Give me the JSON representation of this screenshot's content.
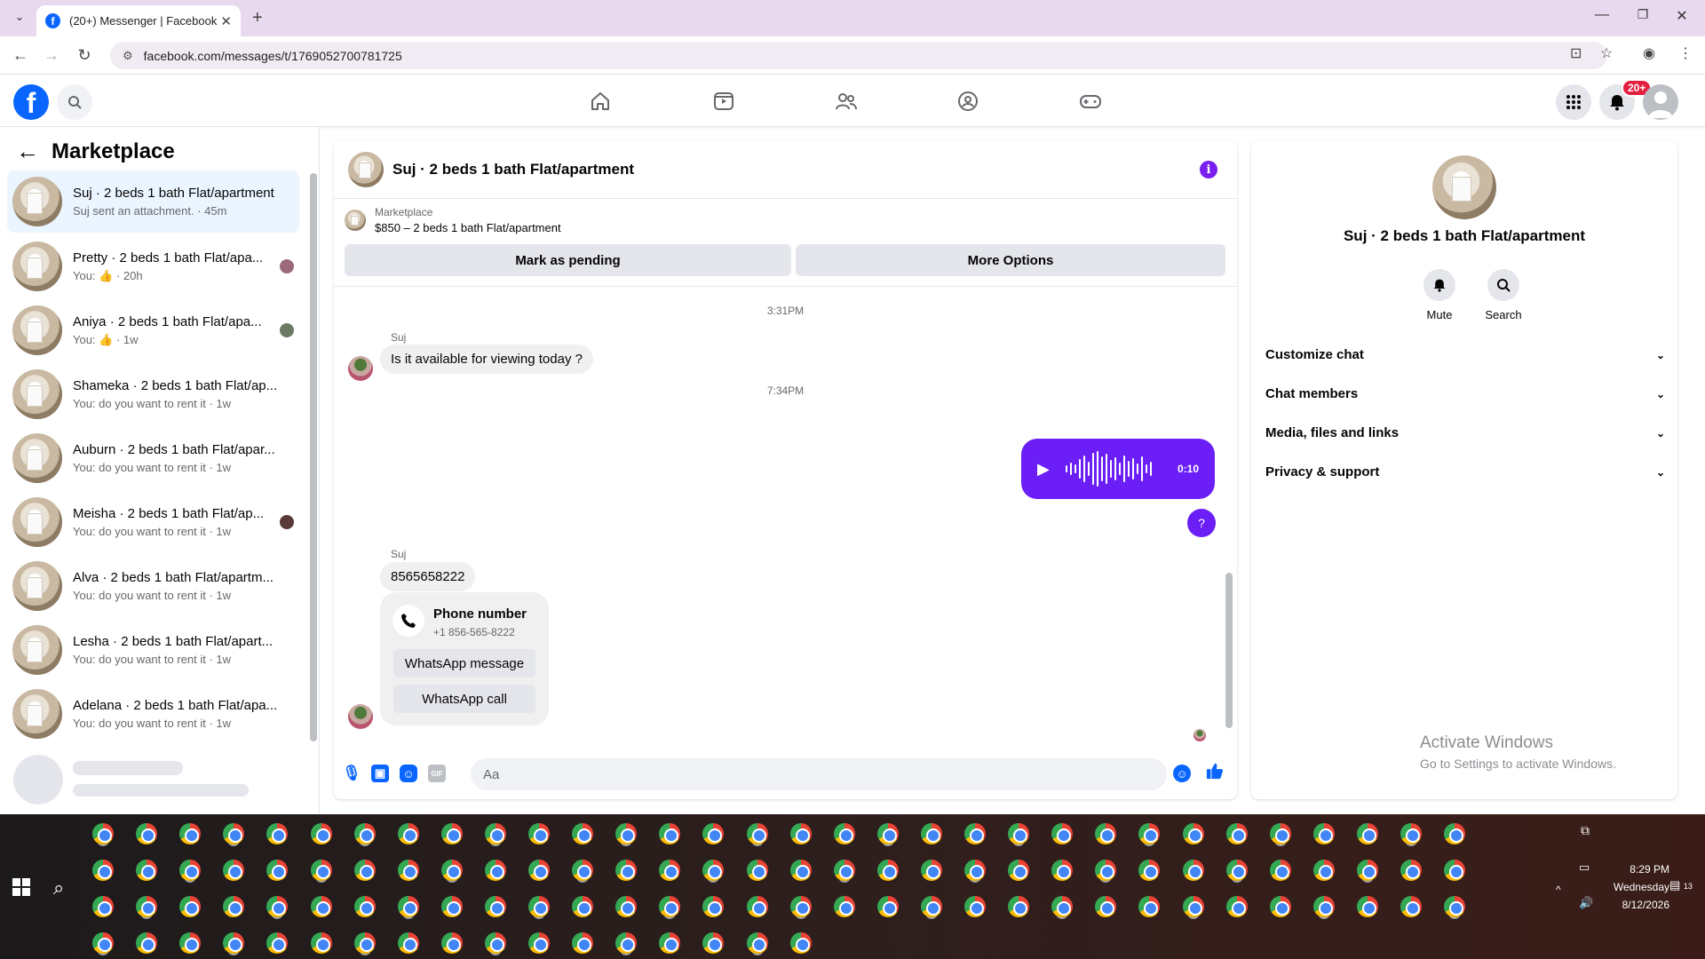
{
  "browser": {
    "tab_title": "(20+) Messenger | Facebook",
    "url": "facebook.com/messages/t/1769052700781725"
  },
  "header": {
    "notifications_badge": "20+"
  },
  "sidebar": {
    "title": "Marketplace",
    "conversations": [
      {
        "name": "Suj · 2 beds 1 bath Flat/apartment",
        "sub": "Suj sent an attachment. · 45m",
        "active": true
      },
      {
        "name": "Pretty · 2 beds 1 bath Flat/apa...",
        "sub": "You: 👍 · 20h"
      },
      {
        "name": "Aniya · 2 beds 1 bath Flat/apa...",
        "sub": "You: 👍 · 1w"
      },
      {
        "name": "Shameka · 2 beds 1 bath Flat/ap...",
        "sub": "You: do you want to rent it · 1w"
      },
      {
        "name": "Auburn · 2 beds 1 bath Flat/apar...",
        "sub": "You: do you want to rent it · 1w"
      },
      {
        "name": "Meisha · 2 beds 1 bath Flat/ap...",
        "sub": "You: do you want to rent it · 1w"
      },
      {
        "name": "Alva · 2 beds 1 bath Flat/apartm...",
        "sub": "You: do you want to rent it · 1w"
      },
      {
        "name": "Lesha · 2 beds 1 bath Flat/apart...",
        "sub": "You: do you want to rent it · 1w"
      },
      {
        "name": "Adelana · 2 beds 1 bath Flat/apa...",
        "sub": "You: do you want to rent it · 1w"
      }
    ]
  },
  "chat": {
    "title": "Suj · 2 beds 1 bath Flat/apartment",
    "listing_label": "Marketplace",
    "listing_text": "$850 – 2 beds 1 bath Flat/apartment",
    "mark_pending": "Mark as pending",
    "more_options": "More Options",
    "ts1": "3:31PM",
    "sender1": "Suj",
    "msg1": "Is it available for viewing today ?",
    "ts2": "7:34PM",
    "voice_duration": "0:10",
    "sent_q": "?",
    "sender2": "Suj",
    "msg2": "8565658222",
    "phone_title": "Phone number",
    "phone_number": "+1 856-565-8222",
    "whatsapp_message": "WhatsApp message",
    "whatsapp_call": "WhatsApp call",
    "input_placeholder": "Aa"
  },
  "details": {
    "title": "Suj · 2 beds 1 bath Flat/apartment",
    "mute": "Mute",
    "search": "Search",
    "sections": [
      "Customize chat",
      "Chat members",
      "Media, files and links",
      "Privacy & support"
    ]
  },
  "watermark": {
    "line1": "Activate Windows",
    "line2": "Go to Settings to activate Windows."
  },
  "taskbar": {
    "time": "8:29 PM",
    "day": "Wednesday",
    "date": "8/12/2026",
    "notif_count": "13"
  }
}
